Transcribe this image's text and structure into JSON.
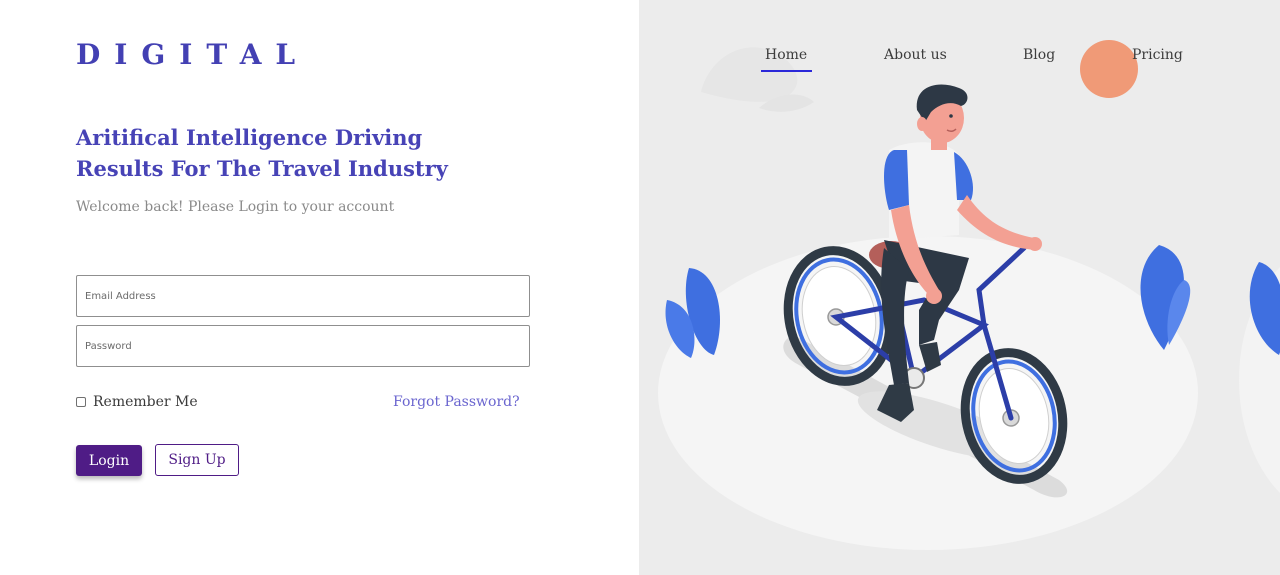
{
  "brand": {
    "name": "DIGITAL"
  },
  "headline": {
    "line1": "Aritifical Intelligence Driving",
    "line2": "Results For The Travel Industry"
  },
  "subtitle": "Welcome back! Please Login to your account",
  "form": {
    "email_placeholder": "Email Address",
    "password_placeholder": "Password",
    "remember_label": "Remember Me",
    "forgot_label": "Forgot Password?",
    "login_label": "Login",
    "signup_label": "Sign Up"
  },
  "nav": {
    "items": [
      {
        "label": "Home",
        "active": true
      },
      {
        "label": "About us",
        "active": false
      },
      {
        "label": "Blog",
        "active": false
      },
      {
        "label": "Pricing",
        "active": false
      }
    ]
  },
  "colors": {
    "brand": "#4340b3",
    "primary_button": "#4f1c86",
    "link": "#6a65cf",
    "nav_active_underline": "#2b28d9",
    "illustration_bg": "#ececec",
    "accent_circle": "#f09a77",
    "plant": "#3f6fe0"
  },
  "illustration": {
    "subject": "person-riding-bicycle-illustration"
  }
}
